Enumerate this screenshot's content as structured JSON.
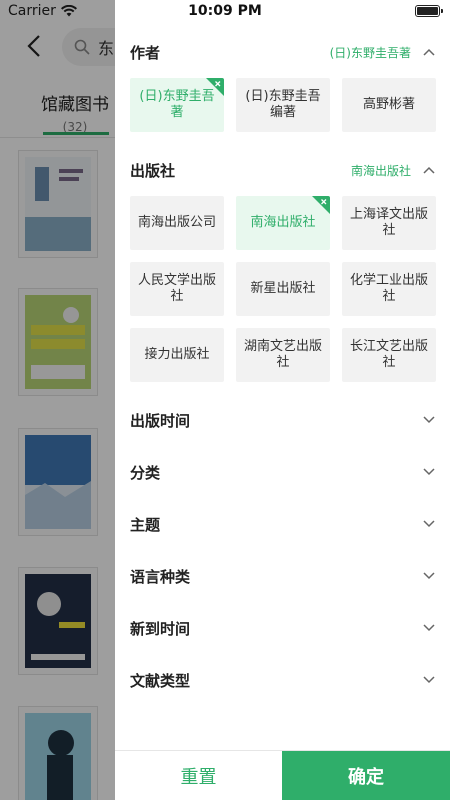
{
  "status_bar": {
    "carrier": "Carrier",
    "time": "10:09 PM"
  },
  "background": {
    "search_text": "东",
    "tab_label": "馆藏图书",
    "tab_count": "(32)"
  },
  "filters": {
    "author": {
      "title": "作者",
      "selected": "(日)东野圭吾著",
      "options": [
        "(日)东野圭吾著",
        "(日)东野圭吾编著",
        "高野彬著"
      ]
    },
    "publisher": {
      "title": "出版社",
      "selected": "南海出版社",
      "options": [
        "南海出版公司",
        "南海出版社",
        "上海译文出版社",
        "人民文学出版社",
        "新星出版社",
        "化学工业出版社",
        "接力出版社",
        "湖南文艺出版社",
        "长江文艺出版社"
      ]
    },
    "collapsed": [
      "出版时间",
      "分类",
      "主题",
      "语言种类",
      "新到时间",
      "文献类型"
    ]
  },
  "footer": {
    "reset_label": "重置",
    "confirm_label": "确定"
  },
  "colors": {
    "accent": "#2fae6a",
    "selected_bg": "#e8f8ee",
    "chip_bg": "#f2f2f2"
  }
}
